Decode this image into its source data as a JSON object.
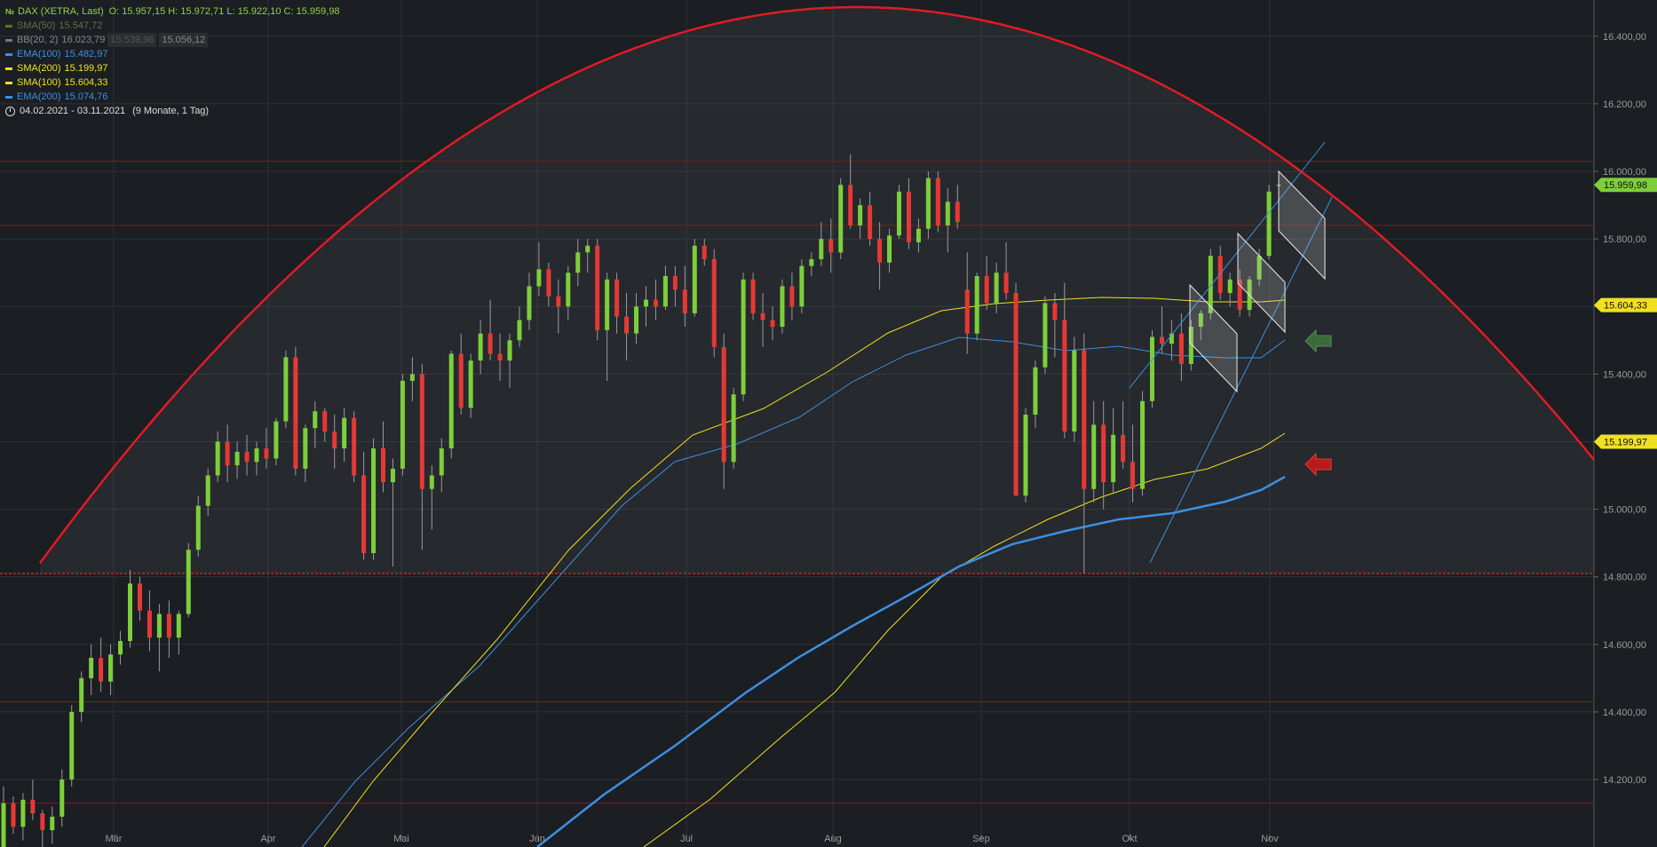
{
  "legend": {
    "instrument": "DAX (XETRA, Last)",
    "ohlc": "O: 15.957,15  H: 15.972,71  L: 15.922,10  C: 15.959,98",
    "indicators": [
      {
        "name": "SMA(50)",
        "value": "15.547,72",
        "color": "#6b6b2a"
      },
      {
        "name": "BB(20, 2)",
        "value": "16.023,79",
        "value2": "15.539,96",
        "value3": "15.056,12",
        "color": "#777777"
      },
      {
        "name": "EMA(100)",
        "value": "15.482,97",
        "color": "#3d8fe0"
      },
      {
        "name": "SMA(200)",
        "value": "15.199,97",
        "color": "#f0e020"
      },
      {
        "name": "SMA(100)",
        "value": "15.604,33",
        "color": "#f0e020"
      },
      {
        "name": "EMA(200)",
        "value": "15.074,76",
        "color": "#3d8fe0"
      }
    ],
    "period": "04.02.2021 - 03.11.2021",
    "period_note": "(9 Monate, 1 Tag)"
  },
  "chart_data": {
    "type": "candlestick",
    "ylim": [
      14000,
      16700
    ],
    "y_ticks": [
      "14.200,00",
      "14.400,00",
      "14.600,00",
      "14.800,00",
      "15.000,00",
      "15.200,00",
      "15.400,00",
      "15.600,00",
      "15.800,00",
      "16.000,00",
      "16.200,00",
      "16.400,00"
    ],
    "x_labels": [
      "Mär",
      "Apr",
      "Mai",
      "Jun",
      "Jul",
      "Aug",
      "Sep",
      "Okt",
      "Nov"
    ],
    "price_tags": [
      {
        "value": "15.959,98",
        "color": "#7ccf3a"
      },
      {
        "value": "15.604,33",
        "color": "#f0e020"
      },
      {
        "value": "15.199,97",
        "color": "#f0e020"
      }
    ],
    "candles_approx": [
      [
        14000,
        14180,
        13960,
        14130
      ],
      [
        14130,
        14150,
        14040,
        14060
      ],
      [
        14060,
        14160,
        14020,
        14140
      ],
      [
        14140,
        14200,
        14080,
        14100
      ],
      [
        14100,
        14110,
        14000,
        14050
      ],
      [
        14050,
        14120,
        14010,
        14090
      ],
      [
        14090,
        14230,
        14060,
        14200
      ],
      [
        14200,
        14420,
        14180,
        14400
      ],
      [
        14400,
        14520,
        14370,
        14500
      ],
      [
        14500,
        14600,
        14450,
        14560
      ],
      [
        14560,
        14620,
        14460,
        14490
      ],
      [
        14490,
        14600,
        14450,
        14570
      ],
      [
        14570,
        14640,
        14540,
        14610
      ],
      [
        14610,
        14820,
        14590,
        14780
      ],
      [
        14780,
        14800,
        14670,
        14700
      ],
      [
        14700,
        14760,
        14580,
        14620
      ],
      [
        14620,
        14720,
        14520,
        14690
      ],
      [
        14690,
        14730,
        14560,
        14620
      ],
      [
        14620,
        14700,
        14570,
        14690
      ],
      [
        14690,
        14900,
        14680,
        14880
      ],
      [
        14880,
        15040,
        14860,
        15010
      ],
      [
        15010,
        15120,
        14980,
        15100
      ],
      [
        15100,
        15230,
        15080,
        15200
      ],
      [
        15200,
        15250,
        15080,
        15130
      ],
      [
        15130,
        15200,
        15090,
        15170
      ],
      [
        15170,
        15220,
        15100,
        15140
      ],
      [
        15140,
        15200,
        15100,
        15180
      ],
      [
        15180,
        15240,
        15120,
        15150
      ],
      [
        15150,
        15270,
        15130,
        15260
      ],
      [
        15260,
        15470,
        15240,
        15450
      ],
      [
        15450,
        15480,
        15100,
        15120
      ],
      [
        15120,
        15250,
        15080,
        15240
      ],
      [
        15240,
        15320,
        15180,
        15290
      ],
      [
        15290,
        15300,
        15200,
        15230
      ],
      [
        15230,
        15280,
        15120,
        15180
      ],
      [
        15180,
        15300,
        15140,
        15270
      ],
      [
        15270,
        15290,
        15080,
        15100
      ],
      [
        15100,
        15170,
        14850,
        14870
      ],
      [
        14870,
        15210,
        14850,
        15180
      ],
      [
        15180,
        15260,
        15050,
        15080
      ],
      [
        15080,
        15150,
        14830,
        15120
      ],
      [
        15120,
        15400,
        15100,
        15380
      ],
      [
        15380,
        15450,
        15320,
        15400
      ],
      [
        15400,
        15430,
        14880,
        15060
      ],
      [
        15060,
        15130,
        14940,
        15100
      ],
      [
        15100,
        15210,
        15050,
        15180
      ],
      [
        15180,
        15470,
        15150,
        15460
      ],
      [
        15460,
        15520,
        15280,
        15300
      ],
      [
        15300,
        15460,
        15270,
        15440
      ],
      [
        15440,
        15560,
        15400,
        15520
      ],
      [
        15520,
        15620,
        15440,
        15460
      ],
      [
        15460,
        15520,
        15380,
        15440
      ],
      [
        15440,
        15520,
        15360,
        15500
      ],
      [
        15500,
        15600,
        15480,
        15560
      ],
      [
        15560,
        15700,
        15530,
        15660
      ],
      [
        15660,
        15790,
        15630,
        15710
      ],
      [
        15710,
        15730,
        15600,
        15630
      ],
      [
        15630,
        15680,
        15520,
        15600
      ],
      [
        15600,
        15720,
        15560,
        15700
      ],
      [
        15700,
        15800,
        15660,
        15760
      ],
      [
        15760,
        15800,
        15700,
        15780
      ],
      [
        15780,
        15800,
        15500,
        15530
      ],
      [
        15530,
        15700,
        15380,
        15680
      ],
      [
        15680,
        15700,
        15520,
        15570
      ],
      [
        15570,
        15640,
        15440,
        15520
      ],
      [
        15520,
        15640,
        15490,
        15600
      ],
      [
        15600,
        15660,
        15540,
        15620
      ],
      [
        15620,
        15680,
        15560,
        15600
      ],
      [
        15600,
        15720,
        15590,
        15690
      ],
      [
        15690,
        15720,
        15600,
        15650
      ],
      [
        15650,
        15720,
        15540,
        15580
      ],
      [
        15580,
        15800,
        15570,
        15780
      ],
      [
        15780,
        15800,
        15720,
        15740
      ],
      [
        15740,
        15770,
        15450,
        15480
      ],
      [
        15480,
        15520,
        15060,
        15140
      ],
      [
        15140,
        15360,
        15120,
        15340
      ],
      [
        15340,
        15700,
        15320,
        15680
      ],
      [
        15680,
        15700,
        15560,
        15580
      ],
      [
        15580,
        15640,
        15480,
        15560
      ],
      [
        15560,
        15600,
        15500,
        15540
      ],
      [
        15540,
        15680,
        15520,
        15660
      ],
      [
        15660,
        15700,
        15560,
        15600
      ],
      [
        15600,
        15740,
        15580,
        15720
      ],
      [
        15720,
        15760,
        15690,
        15740
      ],
      [
        15740,
        15850,
        15720,
        15800
      ],
      [
        15800,
        15860,
        15700,
        15760
      ],
      [
        15760,
        15980,
        15740,
        15960
      ],
      [
        15960,
        16050,
        15830,
        15840
      ],
      [
        15840,
        15920,
        15800,
        15900
      ],
      [
        15900,
        15940,
        15780,
        15800
      ],
      [
        15800,
        15850,
        15650,
        15730
      ],
      [
        15730,
        15830,
        15700,
        15810
      ],
      [
        15810,
        15960,
        15800,
        15940
      ],
      [
        15940,
        15980,
        15770,
        15790
      ],
      [
        15790,
        15860,
        15760,
        15830
      ],
      [
        15830,
        16000,
        15800,
        15980
      ],
      [
        15980,
        16000,
        15820,
        15840
      ],
      [
        15840,
        15950,
        15760,
        15910
      ],
      [
        15910,
        15960,
        15830,
        15850
      ]
    ],
    "candles_late": [
      [
        15650,
        15760,
        15460,
        15520
      ],
      [
        15520,
        15700,
        15500,
        15690
      ],
      [
        15690,
        15750,
        15590,
        15610
      ],
      [
        15610,
        15730,
        15580,
        15700
      ],
      [
        15700,
        15790,
        15620,
        15640
      ],
      [
        15640,
        15670,
        15040,
        15040
      ],
      [
        15040,
        15300,
        15020,
        15280
      ],
      [
        15280,
        15440,
        15240,
        15420
      ],
      [
        15420,
        15630,
        15400,
        15610
      ],
      [
        15610,
        15640,
        15450,
        15560
      ],
      [
        15560,
        15670,
        15210,
        15230
      ],
      [
        15230,
        15510,
        15200,
        15470
      ],
      [
        15470,
        15520,
        14810,
        15060
      ],
      [
        15060,
        15320,
        15020,
        15250
      ],
      [
        15250,
        15320,
        15000,
        15080
      ],
      [
        15080,
        15300,
        15050,
        15220
      ],
      [
        15220,
        15320,
        15120,
        15140
      ],
      [
        15140,
        15250,
        15020,
        15060
      ],
      [
        15060,
        15350,
        15040,
        15320
      ],
      [
        15320,
        15530,
        15300,
        15510
      ],
      [
        15510,
        15600,
        15460,
        15490
      ],
      [
        15490,
        15560,
        15440,
        15520
      ],
      [
        15520,
        15580,
        15380,
        15430
      ],
      [
        15430,
        15560,
        15410,
        15540
      ],
      [
        15540,
        15590,
        15500,
        15580
      ],
      [
        15580,
        15770,
        15560,
        15750
      ],
      [
        15750,
        15780,
        15620,
        15640
      ],
      [
        15640,
        15700,
        15600,
        15680
      ],
      [
        15680,
        15710,
        15570,
        15590
      ],
      [
        15590,
        15690,
        15570,
        15680
      ],
      [
        15680,
        15770,
        15660,
        15750
      ],
      [
        15750,
        15960,
        15740,
        15940
      ],
      [
        15957,
        15973,
        15922,
        15960
      ]
    ]
  }
}
